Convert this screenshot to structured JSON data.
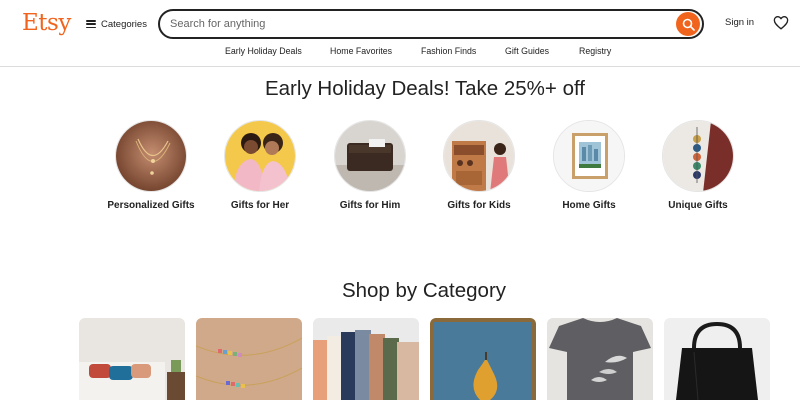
{
  "header": {
    "logo": "Etsy",
    "categories_label": "Categories",
    "search_placeholder": "Search for anything",
    "signin_label": "Sign in"
  },
  "nav": {
    "items": [
      "Early Holiday Deals",
      "Home Favorites",
      "Fashion Finds",
      "Gift Guides",
      "Registry"
    ]
  },
  "deals": {
    "title": "Early Holiday Deals! Take 25%+ off",
    "items": [
      {
        "label": "Personalized Gifts"
      },
      {
        "label": "Gifts for Her"
      },
      {
        "label": "Gifts for Him"
      },
      {
        "label": "Gifts for Kids"
      },
      {
        "label": "Home Gifts"
      },
      {
        "label": "Unique Gifts"
      }
    ]
  },
  "category": {
    "title": "Shop by Category"
  },
  "colors": {
    "brand": "#f1641e",
    "text": "#222222"
  }
}
